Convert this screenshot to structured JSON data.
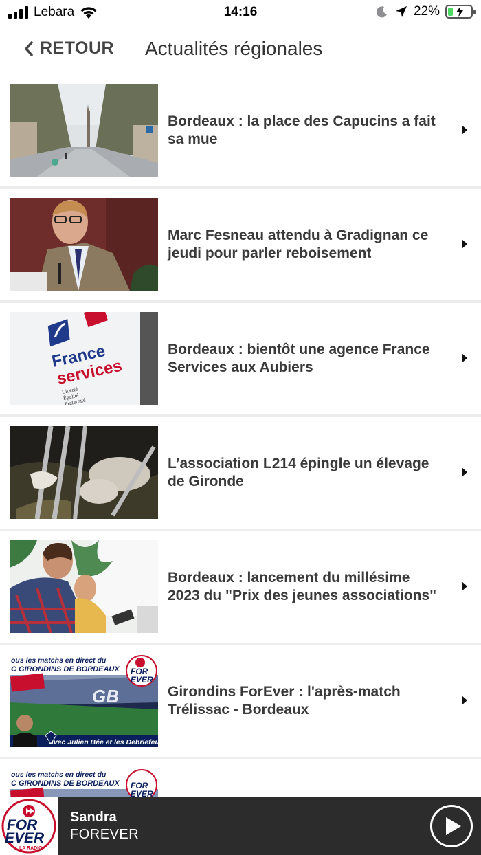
{
  "status": {
    "carrier": "Lebara",
    "time": "14:16",
    "battery_percent": "22%",
    "battery_level": 0.22
  },
  "nav": {
    "back_label": "RETOUR",
    "title": "Actualités régionales"
  },
  "articles": [
    {
      "title": "Bordeaux : la place des Capucins a fait sa mue"
    },
    {
      "title": "Marc Fesneau attendu à Gradignan ce jeudi pour parler reboisement"
    },
    {
      "title": "Bordeaux : bientôt une agence France Services aux Aubiers"
    },
    {
      "title": "L’association L214 épingle un élevage de Gironde"
    },
    {
      "title": "Bordeaux : lancement du millésime 2023 du \"Prix des jeunes associations\""
    },
    {
      "title": "Girondins ForEver : l'après-match Trélissac - Bordeaux"
    },
    {
      "title": ""
    }
  ],
  "thumb_text": {
    "france": "France",
    "services": "services",
    "motto1": "Liberté",
    "motto2": "Égalité",
    "motto3": "Fraternité",
    "banner_line1": "ous les matchs en direct du",
    "banner_line2": "C GIRONDINS DE BORDEAUX",
    "banner_footer": "avec Julien Bée et les Debriefeur",
    "forever_logo": "FOR EVER",
    "badge": "Girondins FOREVER"
  },
  "player": {
    "station": "Sandra",
    "program": "FOREVER",
    "logo_text": "FOR EVER",
    "logo_sub": "LA RADIO"
  },
  "colors": {
    "accent_navy": "#1f3a8a",
    "accent_red": "#c8102e",
    "player_bg": "#2c2c2c",
    "battery_green": "#4cd964"
  }
}
